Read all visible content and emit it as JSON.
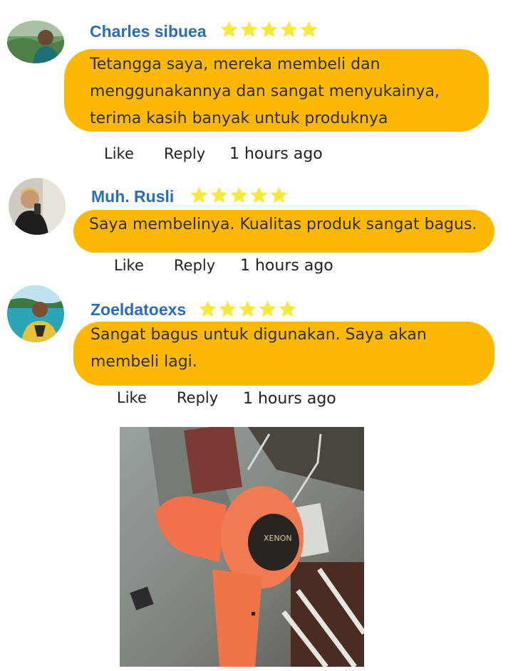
{
  "comments": [
    {
      "author": "Charles sibuea",
      "rating": 5,
      "text_lines": [
        "Tetangga saya, mereka membeli dan",
        "menggunakannya dan sangat menyukainya,",
        "terima kasih banyak untuk produknya"
      ],
      "like": "Like",
      "reply": "Reply",
      "time": "1 hours ago"
    },
    {
      "author": "Muh. Rusli",
      "rating": 5,
      "text_lines": [
        "Saya membelinya. Kualitas produk sangat bagus."
      ],
      "like": "Like",
      "reply": "Reply",
      "time": "1 hours ago"
    },
    {
      "author": "Zoeldatoexs",
      "rating": 5,
      "text_lines": [
        "Sangat bagus untuk digunakan. Saya akan",
        "membeli lagi."
      ],
      "like": "Like",
      "reply": "Reply",
      "time": "1 hours ago"
    }
  ],
  "photo": {
    "brand_text": "XENON"
  },
  "colors": {
    "bubble": "#fdb902",
    "name": "#2a6db5",
    "star": "#f7e93a",
    "text": "#2f2f2f"
  }
}
